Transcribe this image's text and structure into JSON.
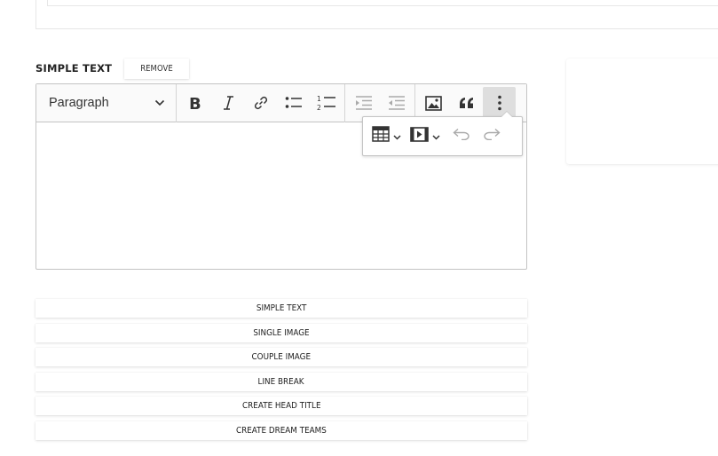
{
  "section": {
    "title": "SIMPLE TEXT",
    "remove_label": "REMOVE"
  },
  "editor": {
    "heading_value": "Paragraph",
    "toolbar_icons": [
      "bold-icon",
      "italic-icon",
      "link-icon",
      "bulleted-list-icon",
      "numbered-list-icon",
      "outdent-icon",
      "indent-icon",
      "image-icon",
      "blockquote-icon",
      "more-vertical-icon"
    ],
    "overflow_icons": [
      "table-icon",
      "media-embed-icon",
      "undo-icon",
      "redo-icon"
    ]
  },
  "blocks": [
    {
      "label": "SIMPLE TEXT"
    },
    {
      "label": "SINGLE IMAGE"
    },
    {
      "label": "COUPLE IMAGE"
    },
    {
      "label": "LINE BREAK"
    },
    {
      "label": "CREATE HEAD TITLE"
    },
    {
      "label": "CREATE DREAM TEAMS"
    }
  ]
}
